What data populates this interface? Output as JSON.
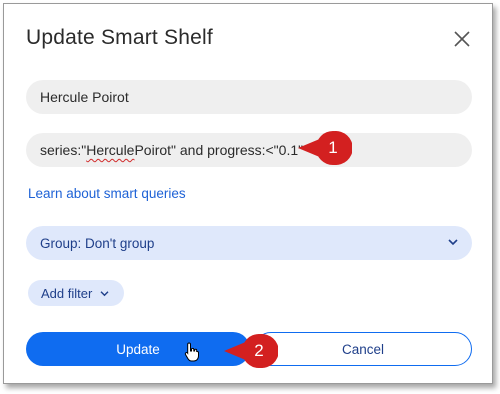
{
  "dialog": {
    "title": "Update Smart Shelf",
    "close_icon": "close-icon"
  },
  "form": {
    "name_value": "Hercule Poirot",
    "query_prefix": "series:\"",
    "query_squiggle": "Hercule",
    "query_suffix": " Poirot\" and progress:<\"0.1\"",
    "learn_link": "Learn about smart queries",
    "group_select": "Group: Don't group",
    "add_filter": "Add filter"
  },
  "buttons": {
    "update": "Update",
    "cancel": "Cancel"
  },
  "callouts": [
    "1",
    "2"
  ],
  "colors": {
    "accent": "#0f6cf0",
    "callout": "#d32020",
    "chip_bg": "#dfe8fb",
    "input_bg": "#efefef",
    "link": "#1e62d6"
  }
}
